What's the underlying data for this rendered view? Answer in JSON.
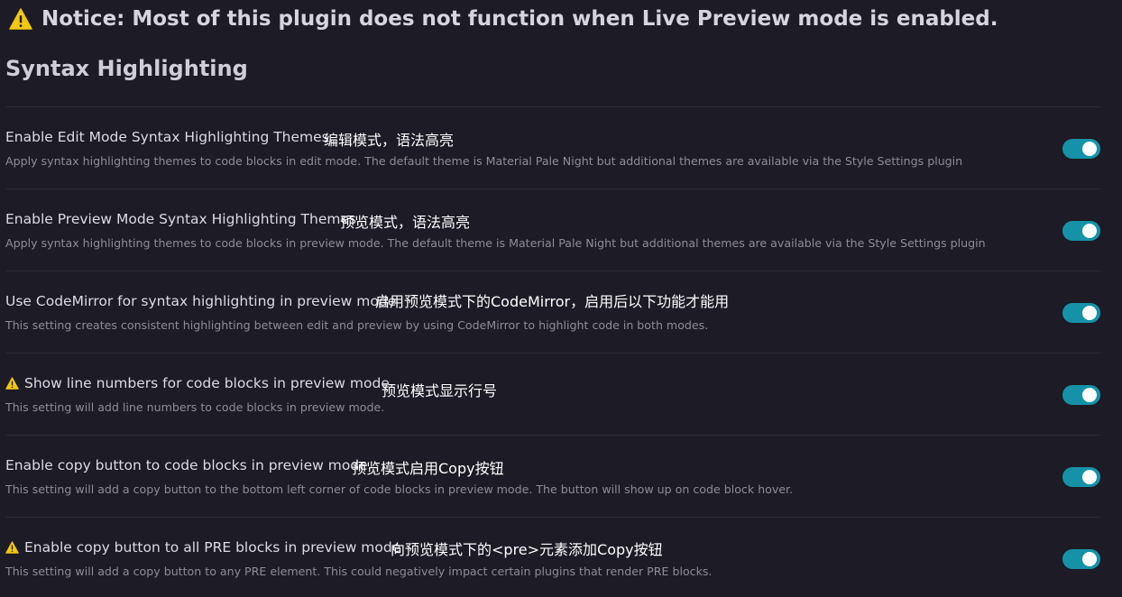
{
  "notice": {
    "icon": "warning-icon",
    "text": "Notice: Most of this plugin does not function when Live Preview mode is enabled."
  },
  "section": {
    "title": "Syntax Highlighting"
  },
  "colors": {
    "background": "#1d1b25",
    "toggle_on": "#1592a8",
    "warning": "#f2c811"
  },
  "settings": [
    {
      "name": "Enable Edit Mode Syntax Highlighting Themes",
      "description": "Apply syntax highlighting themes to code blocks in edit mode. The default theme is Material Pale Night but additional themes are available via the Style Settings plugin",
      "annotation": "编辑模式，语法高亮",
      "warning": false,
      "enabled": true
    },
    {
      "name": "Enable Preview Mode Syntax Highlighting Themes",
      "description": "Apply syntax highlighting themes to code blocks in preview mode. The default theme is Material Pale Night but additional themes are available via the Style Settings plugin",
      "annotation": "预览模式，语法高亮",
      "warning": false,
      "enabled": true
    },
    {
      "name": "Use CodeMirror for syntax highlighting in preview mode",
      "description": "This setting creates consistent highlighting between edit and preview by using CodeMirror to highlight code in both modes.",
      "annotation": "启用预览模式下的CodeMirror，启用后以下功能才能用",
      "warning": false,
      "enabled": true
    },
    {
      "name": "Show line numbers for code blocks in preview mode",
      "description": "This setting will add line numbers to code blocks in preview mode.",
      "annotation": "预览模式显示行号",
      "warning": true,
      "enabled": true
    },
    {
      "name": "Enable copy button to code blocks in preview mode",
      "description": "This setting will add a copy button to the bottom left corner of code blocks in preview mode. The button will show up on code block hover.",
      "annotation": "预览模式启用Copy按钮",
      "warning": false,
      "enabled": true
    },
    {
      "name": "Enable copy button to all PRE blocks in preview mode",
      "description": "This setting will add a copy button to any PRE element. This could negatively impact certain plugins that render PRE blocks.",
      "annotation": "向预览模式下的<pre>元素添加Copy按钮",
      "warning": true,
      "enabled": true
    }
  ]
}
